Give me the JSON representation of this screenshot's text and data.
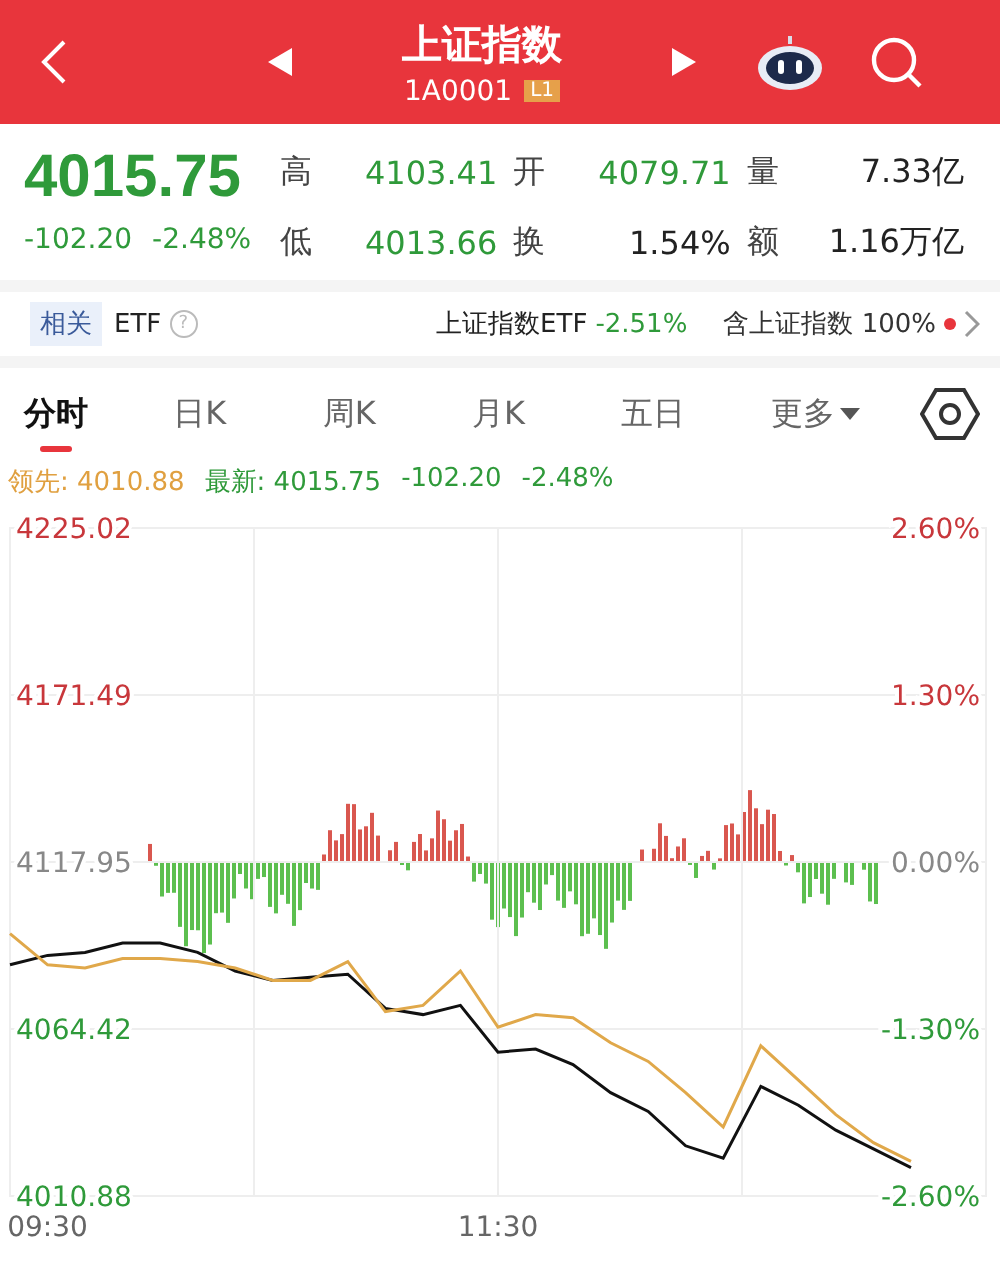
{
  "header": {
    "title": "上证指数",
    "code": "1A0001",
    "level_badge": "L1"
  },
  "quote": {
    "price": "4015.75",
    "change": "-102.20",
    "change_pct": "-2.48%",
    "stats": [
      {
        "label": "高",
        "value": "4103.41",
        "color": "#2f9a3a"
      },
      {
        "label": "开",
        "value": "4079.71",
        "color": "#2f9a3a"
      },
      {
        "label": "量",
        "value": "7.33亿",
        "color": "#222222"
      },
      {
        "label": "低",
        "value": "4013.66",
        "color": "#2f9a3a"
      },
      {
        "label": "换",
        "value": "1.54%",
        "color": "#222222"
      },
      {
        "label": "额",
        "value": "1.16万亿",
        "color": "#222222"
      }
    ]
  },
  "etf_bar": {
    "tag": "相关",
    "label": "ETF",
    "help_glyph": "?",
    "etf_name": "上证指数ETF",
    "etf_change": "-2.51%",
    "holding": "含上证指数 100%",
    "alert": true
  },
  "tabs": [
    {
      "label": "分时",
      "selected": true
    },
    {
      "label": "日K",
      "selected": false
    },
    {
      "label": "周K",
      "selected": false
    },
    {
      "label": "月K",
      "selected": false
    },
    {
      "label": "五日",
      "selected": false
    },
    {
      "label": "更多",
      "selected": false,
      "dropdown": true
    }
  ],
  "legend": {
    "lead_value": "4010.88",
    "latest_value": "4015.75",
    "latest_change": "-102.20",
    "latest_pct": "-2.48%"
  },
  "chart": {
    "right_axis_labels": [
      "2.60%",
      "1.30%",
      "0.00%",
      "-1.30%",
      "-2.60%"
    ],
    "chart_data": {
      "type": "line",
      "categories": [
        null,
        "09:30",
        null,
        null,
        null,
        null,
        null,
        null,
        null,
        null,
        null,
        null,
        null,
        "11:30",
        null,
        null,
        null,
        null,
        null,
        null,
        null,
        null,
        null,
        null,
        null,
        null,
        null
      ],
      "series": [
        {
          "name": "最新:",
          "color": "#111111",
          "values": [
            4085,
            4088,
            4089,
            4092,
            4092,
            4089,
            4083,
            4080,
            4081,
            4082,
            4071,
            4069,
            4072,
            4057,
            4058,
            4053,
            4044,
            4038,
            4027,
            4023,
            4046,
            4040,
            4032,
            4026,
            4020,
            null,
            null
          ]
        },
        {
          "name": "领先:",
          "color": "#e0a84a",
          "values": [
            4095,
            4085,
            4084,
            4087,
            4087,
            4086,
            4084,
            4080,
            4080,
            4086,
            4070,
            4072,
            4083,
            4065,
            4069,
            4068,
            4060,
            4054,
            4044,
            4033,
            4059,
            4048,
            4037,
            4028,
            4022,
            null,
            null
          ]
        }
      ],
      "ylim": [
        4010.88,
        4225.02
      ],
      "grid": true,
      "yticks": [
        {
          "value": 4225.02,
          "label": "4225.02"
        },
        {
          "value": 4171.49,
          "label": "4171.49"
        },
        {
          "value": 4117.95,
          "label": "4117.95"
        },
        {
          "value": 4064.42,
          "label": "4064.42"
        },
        {
          "value": 4010.88,
          "label": "4010.88"
        }
      ]
    }
  }
}
